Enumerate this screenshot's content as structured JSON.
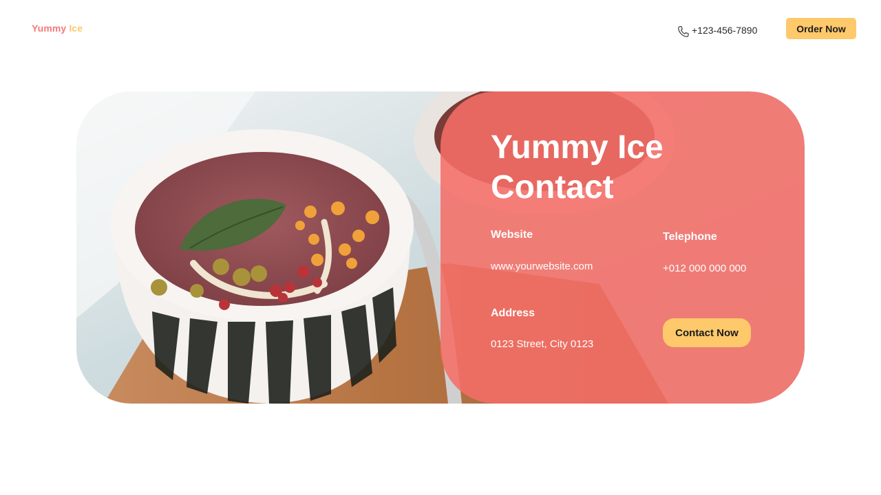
{
  "header": {
    "logo_word1": "Yummy",
    "logo_word2": "Ice",
    "phone": "+123-456-7890",
    "order_label": "Order Now"
  },
  "contact": {
    "title_line1": "Yummy Ice",
    "title_line2": "Contact",
    "website_label": "Website",
    "website_value": "www.yourwebsite.com",
    "telephone_label": "Telephone",
    "telephone_value": "+012 000 000 000",
    "address_label": "Address",
    "address_value": "0123 Street, City 0123",
    "contact_button": "Contact Now"
  },
  "icons": {
    "phone": "phone-icon"
  },
  "colors": {
    "brand_red": "#f47b7b",
    "brand_yellow": "#fcc672",
    "overlay": "#f56e68",
    "button": "#fdc96b"
  }
}
